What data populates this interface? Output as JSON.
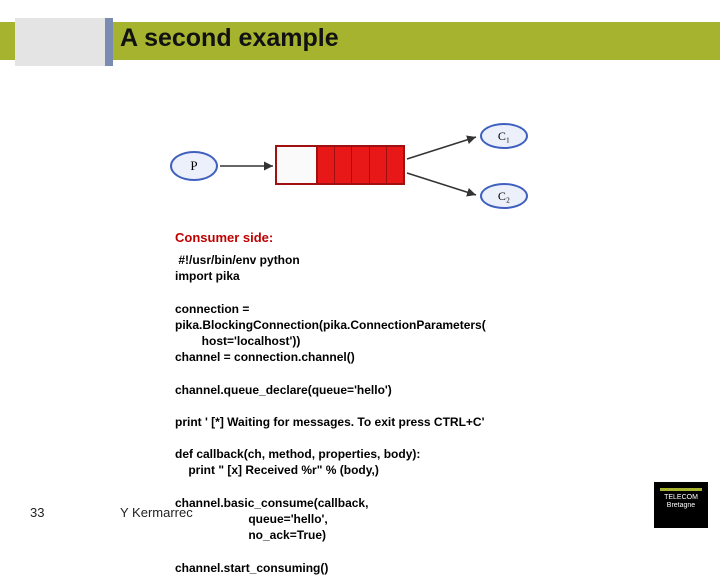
{
  "slide": {
    "title": "A second example",
    "pageNumber": "33",
    "author": "Y Kermarrec"
  },
  "diagram": {
    "producer": "P",
    "consumer1": "C₁",
    "consumer2": "C₂"
  },
  "consumer": {
    "heading": "Consumer side:",
    "code": " #!/usr/bin/env python\nimport pika\n\nconnection =\npika.BlockingConnection(pika.ConnectionParameters(\n        host='localhost'))\nchannel = connection.channel()\n\nchannel.queue_declare(queue='hello')\n\nprint ' [*] Waiting for messages. To exit press CTRL+C'\n\ndef callback(ch, method, properties, body):\n    print \" [x] Received %r\" % (body,)\n\nchannel.basic_consume(callback,\n                      queue='hello',\n                      no_ack=True)\n\nchannel.start_consuming()"
  },
  "logo": {
    "line1": "TELECOM",
    "line2": "Bretagne"
  }
}
